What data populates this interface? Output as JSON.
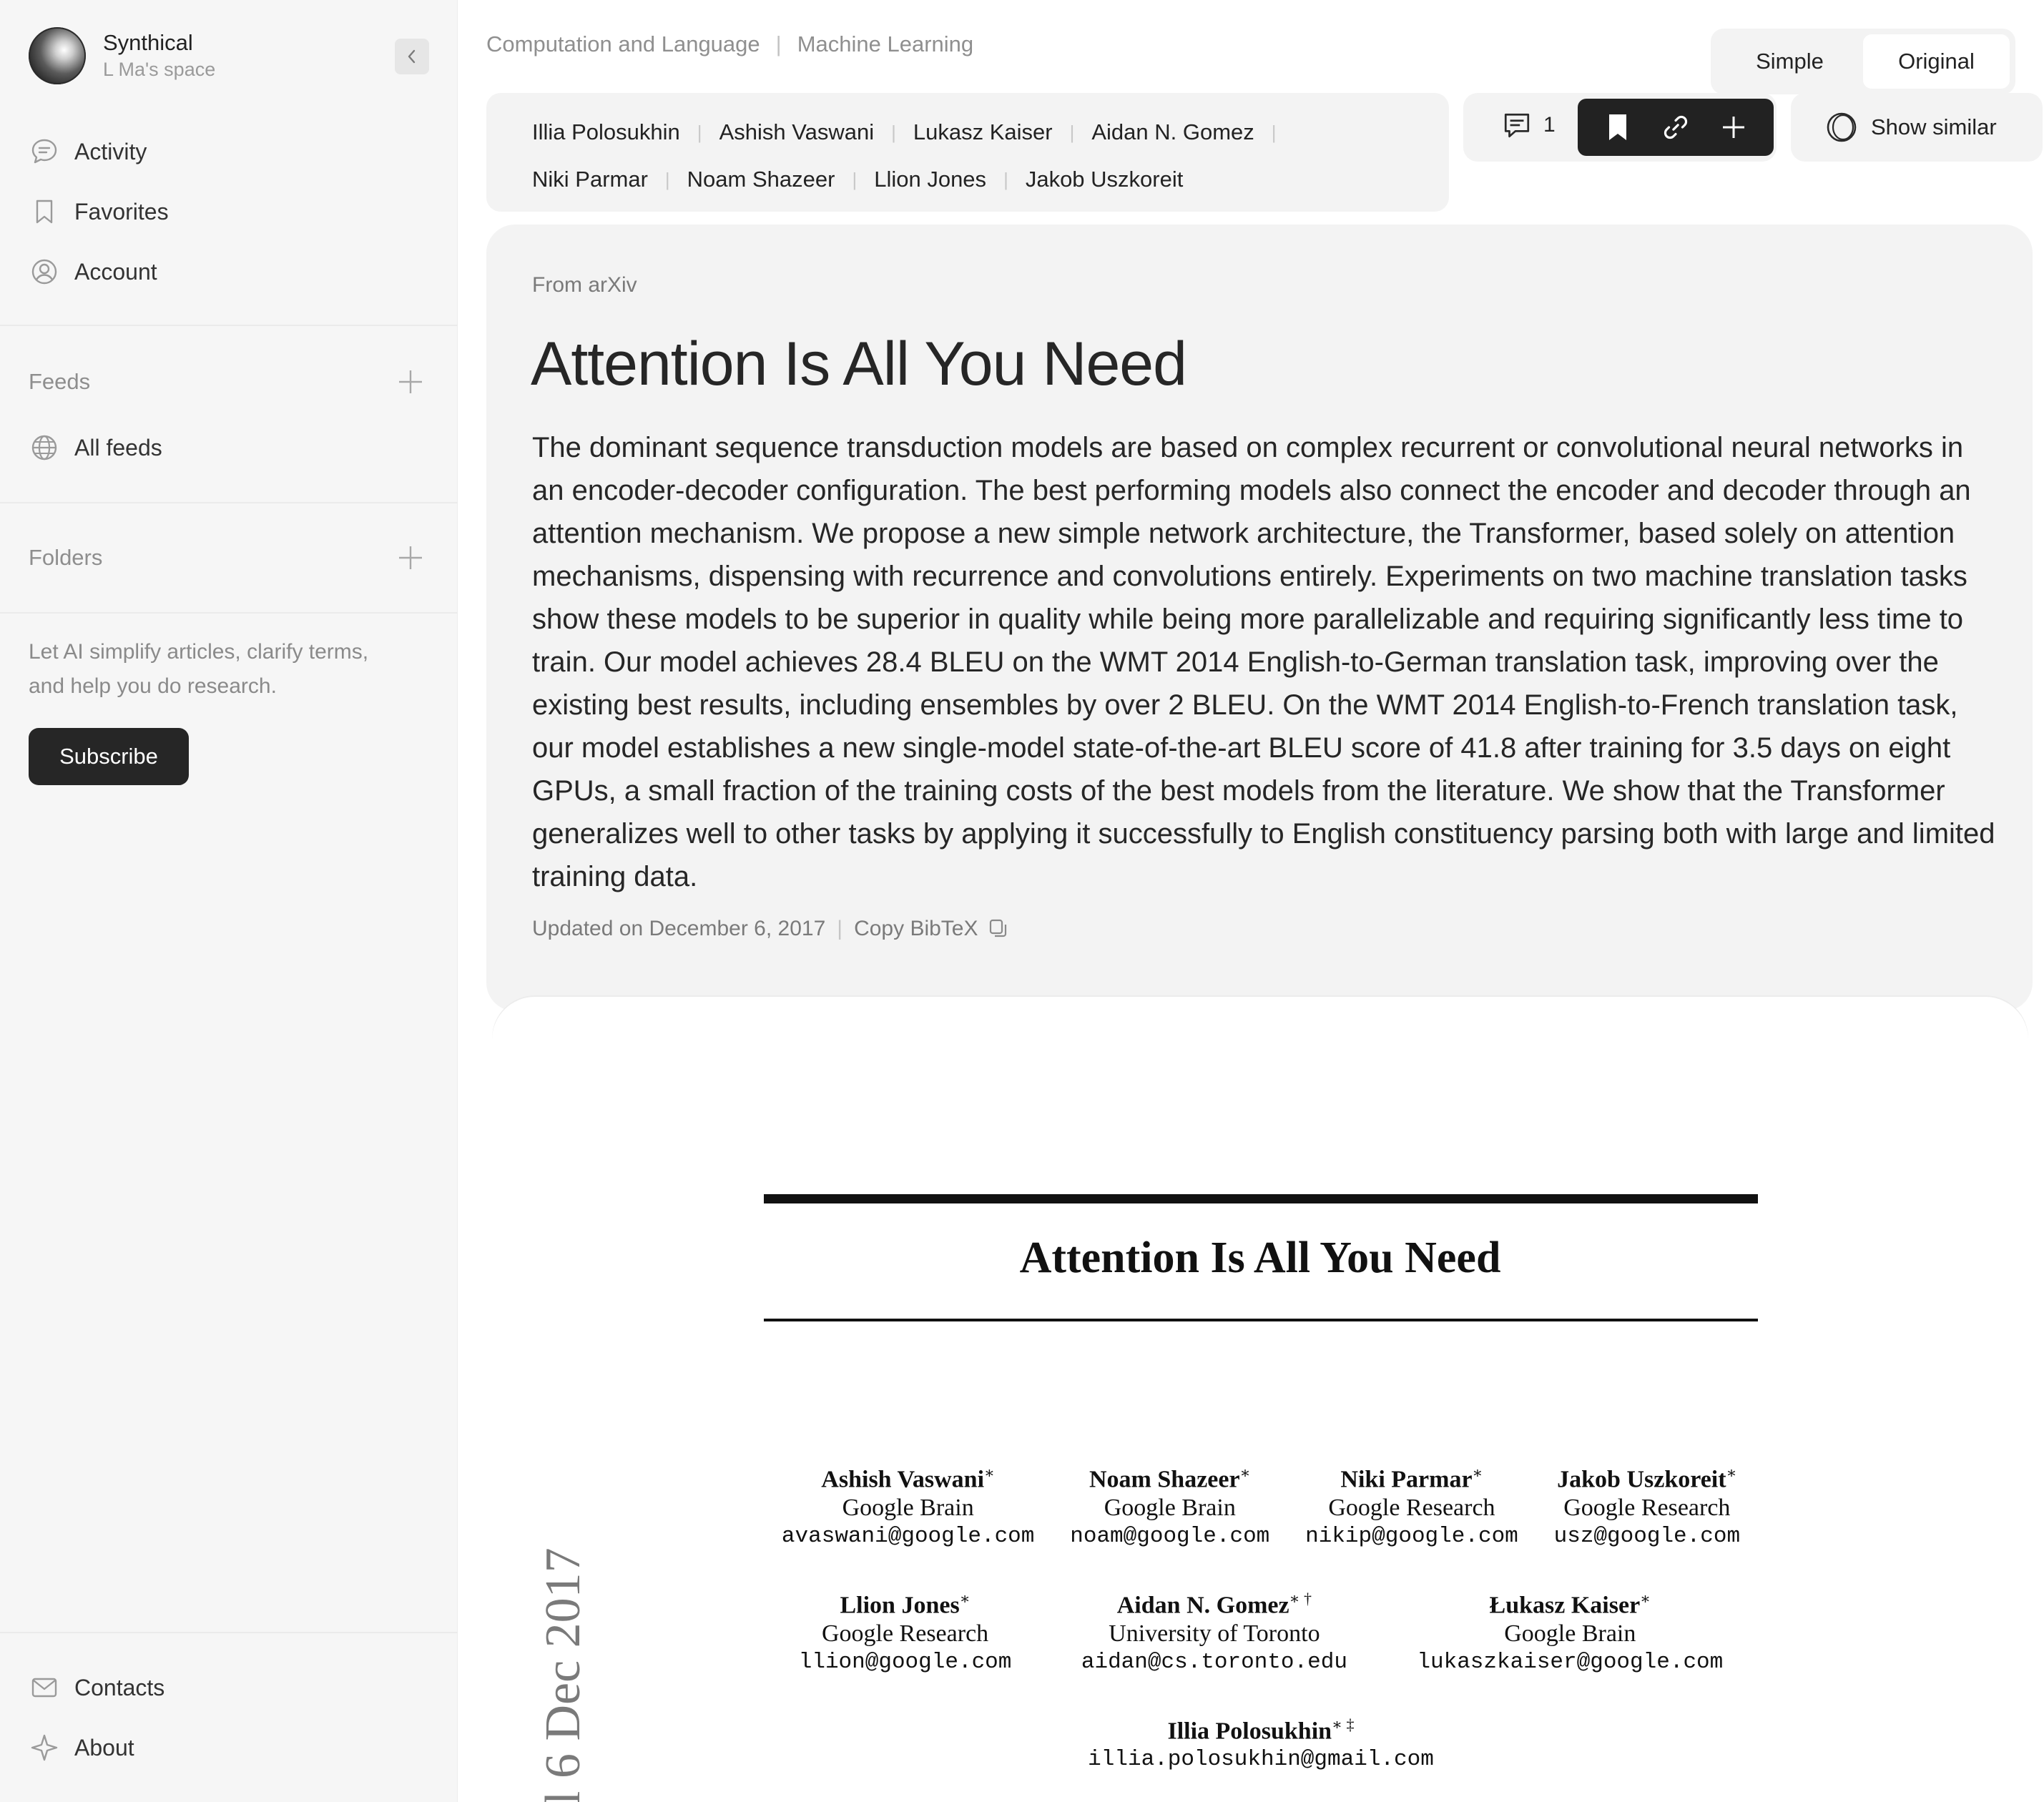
{
  "sidebar": {
    "brand_name": "Synthical",
    "brand_sub": "L Ma's space",
    "nav": [
      {
        "label": "Activity",
        "icon": "chat-bubble-icon"
      },
      {
        "label": "Favorites",
        "icon": "bookmark-icon"
      },
      {
        "label": "Account",
        "icon": "user-circle-icon"
      }
    ],
    "feeds_title": "Feeds",
    "all_feeds_label": "All feeds",
    "folders_title": "Folders",
    "promo_text": "Let AI simplify articles, clarify terms, and help you do research.",
    "subscribe_label": "Subscribe",
    "footer": [
      {
        "label": "Contacts",
        "icon": "mail-icon"
      },
      {
        "label": "About",
        "icon": "compass-icon"
      }
    ]
  },
  "header": {
    "categories": [
      "Computation and Language",
      "Machine Learning"
    ],
    "view_simple": "Simple",
    "view_original": "Original",
    "authors_row1": [
      "Illia Polosukhin",
      "Ashish Vaswani",
      "Lukasz Kaiser",
      "Aidan N. Gomez"
    ],
    "authors_row2": [
      "Niki Parmar",
      "Noam Shazeer",
      "Llion Jones",
      "Jakob Uszkoreit"
    ],
    "comment_count": "1",
    "show_similar_label": "Show similar"
  },
  "paper": {
    "source": "From arXiv",
    "title": "Attention Is All You Need",
    "abstract": "The dominant sequence transduction models are based on complex recurrent or convolutional neural networks in an encoder-decoder configuration. The best performing models also connect the encoder and decoder through an attention mechanism. We propose a new simple network architecture, the Transformer, based solely on attention mechanisms, dispensing with recurrence and convolutions entirely. Experiments on two machine translation tasks show these models to be superior in quality while being more parallelizable and requiring significantly less time to train. Our model achieves 28.4 BLEU on the WMT 2014 English-to-German translation task, improving over the existing best results, including ensembles by over 2 BLEU. On the WMT 2014 English-to-French translation task, our model establishes a new single-model state-of-the-art BLEU score of 41.8 after training for 3.5 days on eight GPUs, a small fraction of the training costs of the best models from the literature. We show that the Transformer generalizes well to other tasks by applying it successfully to English constituency parsing both with large and limited training data.",
    "updated": "Updated on December 6, 2017",
    "copy_bibtex": "Copy BibTeX"
  },
  "pdf": {
    "title": "Attention Is All You Need",
    "side_stamp": "l 6 Dec 2017",
    "row1": [
      {
        "name": "Ashish Vaswani",
        "mark": "∗",
        "aff": "Google Brain",
        "email": "avaswani@google.com"
      },
      {
        "name": "Noam Shazeer",
        "mark": "∗",
        "aff": "Google Brain",
        "email": "noam@google.com"
      },
      {
        "name": "Niki Parmar",
        "mark": "∗",
        "aff": "Google Research",
        "email": "nikip@google.com"
      },
      {
        "name": "Jakob Uszkoreit",
        "mark": "∗",
        "aff": "Google Research",
        "email": "usz@google.com"
      }
    ],
    "row2": [
      {
        "name": "Llion Jones",
        "mark": "∗",
        "aff": "Google Research",
        "email": "llion@google.com"
      },
      {
        "name": "Aidan N. Gomez",
        "mark": "∗ †",
        "aff": "University of Toronto",
        "email": "aidan@cs.toronto.edu"
      },
      {
        "name": "Łukasz Kaiser",
        "mark": "∗",
        "aff": "Google Brain",
        "email": "lukaszkaiser@google.com"
      }
    ],
    "row3": [
      {
        "name": "Illia Polosukhin",
        "mark": "∗ ‡",
        "aff": "",
        "email": "illia.polosukhin@gmail.com"
      }
    ]
  }
}
